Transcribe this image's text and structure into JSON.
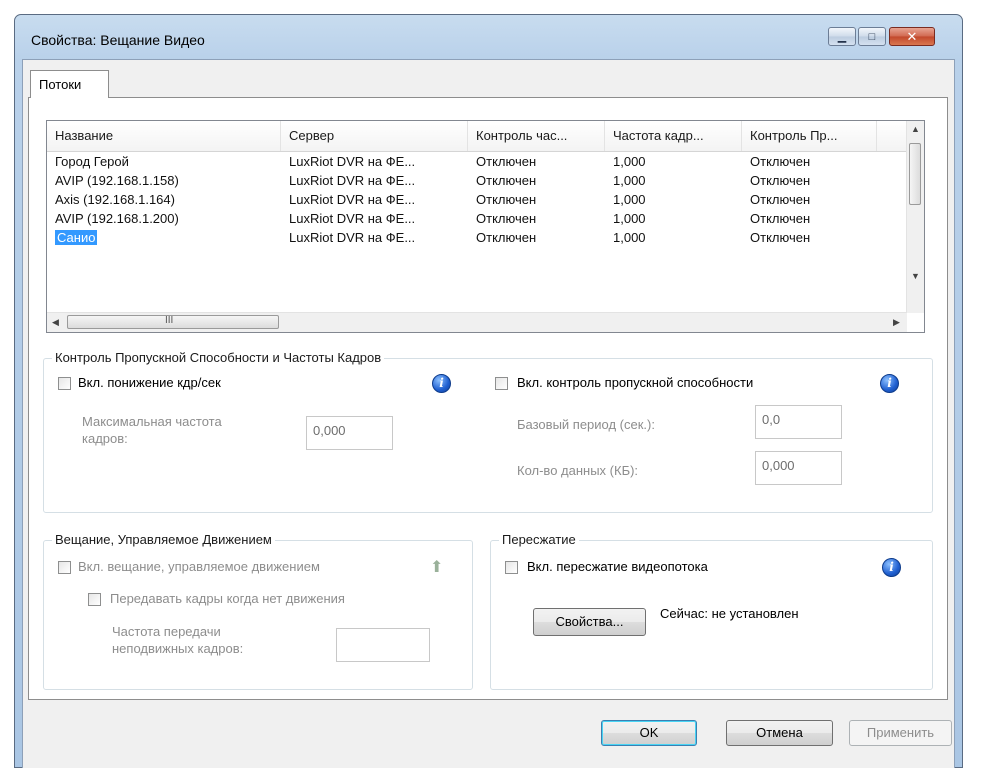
{
  "window": {
    "title": "Свойства: Вещание Видео",
    "controls": {
      "minimize": "▁",
      "maximize": "□",
      "close": "✕"
    }
  },
  "tabs": [
    {
      "label": "Потоки",
      "selected": true
    }
  ],
  "streams_table": {
    "columns": [
      "Название",
      "Сервер",
      "Контроль час...",
      "Частота кадр...",
      "Контроль Пр..."
    ],
    "rows": [
      {
        "name": "Город Герой",
        "server": "LuxRiot DVR на ФЕ...",
        "rate_control": "Отключен",
        "fps": "1,000",
        "bandwidth_control": "Отключен",
        "selected": false
      },
      {
        "name": "AVIP (192.168.1.158)",
        "server": "LuxRiot DVR на ФЕ...",
        "rate_control": "Отключен",
        "fps": "1,000",
        "bandwidth_control": "Отключен",
        "selected": false
      },
      {
        "name": "Axis (192.168.1.164)",
        "server": "LuxRiot DVR на ФЕ...",
        "rate_control": "Отключен",
        "fps": "1,000",
        "bandwidth_control": "Отключен",
        "selected": false
      },
      {
        "name": "AVIP (192.168.1.200)",
        "server": "LuxRiot DVR на ФЕ...",
        "rate_control": "Отключен",
        "fps": "1,000",
        "bandwidth_control": "Отключен",
        "selected": false
      },
      {
        "name": "Санио",
        "server": "LuxRiot DVR на ФЕ...",
        "rate_control": "Отключен",
        "fps": "1,000",
        "bandwidth_control": "Отключен",
        "selected": true
      }
    ],
    "scroll_thumb_glyph": "III"
  },
  "bandwidth_group": {
    "title": "Контроль Пропускной Способности и Частоты Кадров",
    "fps_reduction": {
      "label": "Вкл. понижение кдр/сек",
      "checked": false
    },
    "max_fps": {
      "label_line1": "Максимальная частота",
      "label_line2": "кадров:",
      "value": "0,000"
    },
    "bandwidth_control": {
      "label": "Вкл. контроль пропускной способности",
      "checked": false
    },
    "base_period": {
      "label": "Базовый период (сек.):",
      "value": "0,0"
    },
    "data_amount": {
      "label": "Кол-во данных (КБ):",
      "value": "0,000"
    }
  },
  "motion_group": {
    "title": "Вещание, Управляемое Движением",
    "motion_broadcast": {
      "label": "Вкл. вещание, управляемое движением",
      "checked": false
    },
    "send_frames": {
      "label": "Передавать кадры когда нет движения",
      "checked": false
    },
    "still_rate": {
      "label_line1": "Частота передачи",
      "label_line2": "неподвижных кадров:",
      "value": ""
    }
  },
  "recompress_group": {
    "title": "Пересжатие",
    "enable": {
      "label": "Вкл. пересжатие видеопотока",
      "checked": false
    },
    "properties_button": "Свойства...",
    "status": "Сейчас: не установлен"
  },
  "footer": {
    "ok": "OK",
    "cancel": "Отмена",
    "apply": "Применить"
  },
  "icons": {
    "info": "i",
    "motion": "⬆"
  }
}
